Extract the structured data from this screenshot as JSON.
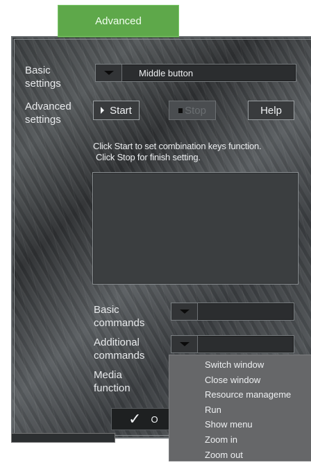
{
  "tab": {
    "label": "Advanced"
  },
  "basic_settings": {
    "label": "Basic settings",
    "dropdown_value": "Middle button"
  },
  "advanced_settings": {
    "label": "Advanced settings"
  },
  "buttons": {
    "start": "Start",
    "stop": "Stop",
    "help": "Help",
    "ok": "O"
  },
  "info_text": {
    "line1": "Click Start to set combination keys function.",
    "line2": "Click Stop for finish setting."
  },
  "basic_commands": {
    "label": "Basic commands",
    "value": ""
  },
  "additional_commands": {
    "label": "Additional commands",
    "value": ""
  },
  "media_function": {
    "label": "Media function"
  },
  "menu": {
    "items": [
      {
        "label": "Switch window"
      },
      {
        "label": "Close window"
      },
      {
        "label": "Resource manageme"
      },
      {
        "label": "Run"
      },
      {
        "label": "Show menu"
      },
      {
        "label": "Zoom in"
      },
      {
        "label": "Zoom out"
      }
    ]
  },
  "colors": {
    "tab_green": "#5ea84a",
    "panel_dark": "#3a3d3f",
    "menu_bg": "#666769"
  }
}
